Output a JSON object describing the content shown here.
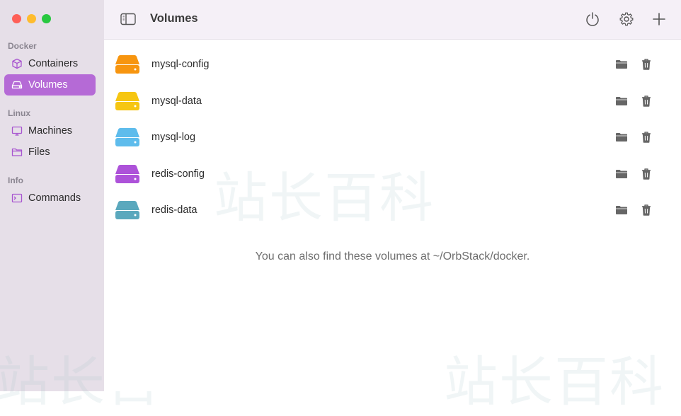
{
  "sidebar": {
    "sections": [
      {
        "label": "Docker"
      },
      {
        "label": "Linux"
      },
      {
        "label": "Info"
      }
    ],
    "items": [
      {
        "label": "Containers"
      },
      {
        "label": "Volumes"
      },
      {
        "label": "Machines"
      },
      {
        "label": "Files"
      },
      {
        "label": "Commands"
      }
    ]
  },
  "toolbar": {
    "title": "Volumes"
  },
  "volumes": [
    {
      "name": "mysql-config",
      "color": "#f7950f"
    },
    {
      "name": "mysql-data",
      "color": "#f6c612"
    },
    {
      "name": "mysql-log",
      "color": "#5ebcec"
    },
    {
      "name": "redis-config",
      "color": "#ad52d9"
    },
    {
      "name": "redis-data",
      "color": "#5aa8bd"
    }
  ],
  "hint": "You can also find these volumes at ~/OrbStack/docker.",
  "colors": {
    "accent": "#b56ad6",
    "sidebar_bg": "#e6dfe8"
  }
}
